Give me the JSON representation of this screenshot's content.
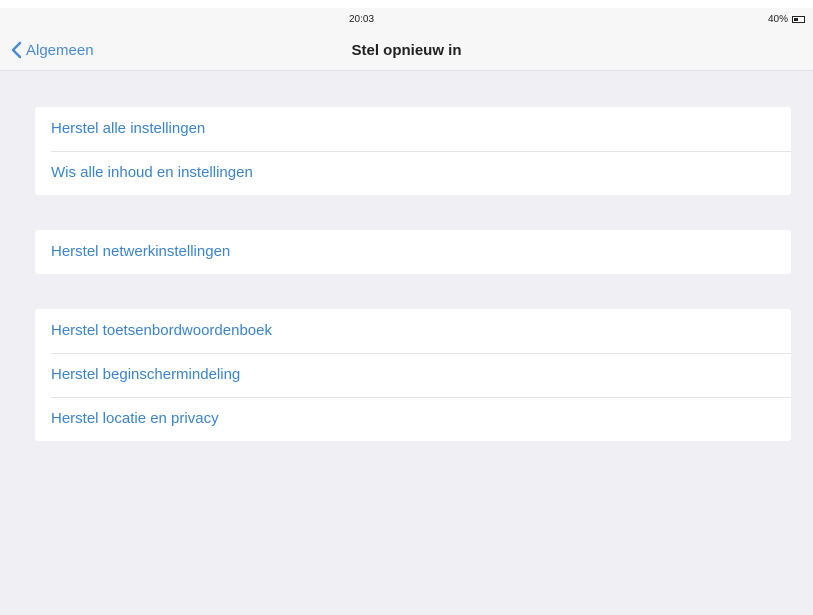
{
  "status_bar": {
    "time": "20:03",
    "battery_pct": "40%",
    "battery_level": 0.4
  },
  "nav": {
    "back_label": "Algemeen",
    "title": "Stel opnieuw in"
  },
  "groups": [
    {
      "items": [
        "Herstel alle instellingen",
        "Wis alle inhoud en instellingen"
      ]
    },
    {
      "items": [
        "Herstel netwerkinstellingen"
      ]
    },
    {
      "items": [
        "Herstel toetsenbordwoordenboek",
        "Herstel beginschermindeling",
        "Herstel locatie en privacy"
      ]
    }
  ],
  "colors": {
    "accent": "#3b84c9",
    "background": "#efeff4"
  },
  "icons": {
    "back": "chevron-left-icon",
    "battery": "battery-icon"
  }
}
